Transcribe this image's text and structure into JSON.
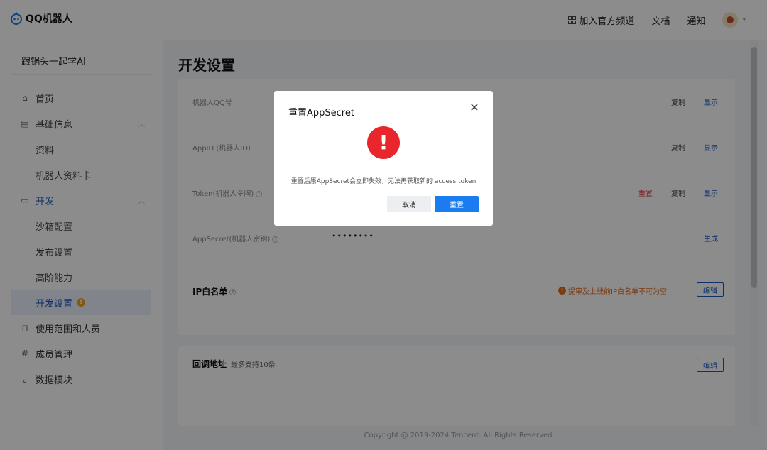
{
  "header": {
    "app_title": "QQ机器人",
    "nav": {
      "join_channel": "加入官方频道",
      "docs": "文档",
      "notify": "通知"
    }
  },
  "sidebar": {
    "bot_name": "跟锅头一起学AI",
    "items": [
      {
        "label": "首页"
      },
      {
        "label": "基础信息"
      },
      {
        "label": "资料"
      },
      {
        "label": "机器人资料卡"
      },
      {
        "label": "开发"
      },
      {
        "label": "沙箱配置"
      },
      {
        "label": "发布设置"
      },
      {
        "label": "高阶能力"
      },
      {
        "label": "开发设置"
      },
      {
        "label": "使用范围和人员"
      },
      {
        "label": "成员管理"
      },
      {
        "label": "数据模块"
      }
    ]
  },
  "main": {
    "page_title": "开发设置",
    "rows": [
      {
        "label": "机器人QQ号",
        "copy": "复制",
        "show": "显示"
      },
      {
        "label": "AppID (机器人ID)",
        "copy": "复制",
        "show": "显示"
      },
      {
        "label": "Token(机器人令牌)",
        "reset": "重置",
        "copy": "复制",
        "show": "显示"
      },
      {
        "label": "AppSecret(机器人密钥)",
        "value": "••••••••",
        "generate": "生成"
      }
    ],
    "ip_whitelist": {
      "title": "IP白名单",
      "warning": "提审及上线前IP白名单不可为空",
      "edit": "编辑"
    },
    "callback": {
      "title": "回调地址",
      "subtitle": "最多支持10条",
      "edit": "编辑"
    }
  },
  "footer": {
    "copyright": "Copyright @ 2019-2024 Tencent. All Rights Reserved"
  },
  "modal": {
    "title": "重置AppSecret",
    "message": "重置后原AppSecret会立即失效，无法再获取新的 access token",
    "cancel": "取消",
    "confirm": "重置"
  },
  "colors": {
    "accent": "#1b5ac4",
    "primary_button": "#1b7cf0",
    "danger": "#e8262c",
    "warning": "#e26a1b"
  }
}
